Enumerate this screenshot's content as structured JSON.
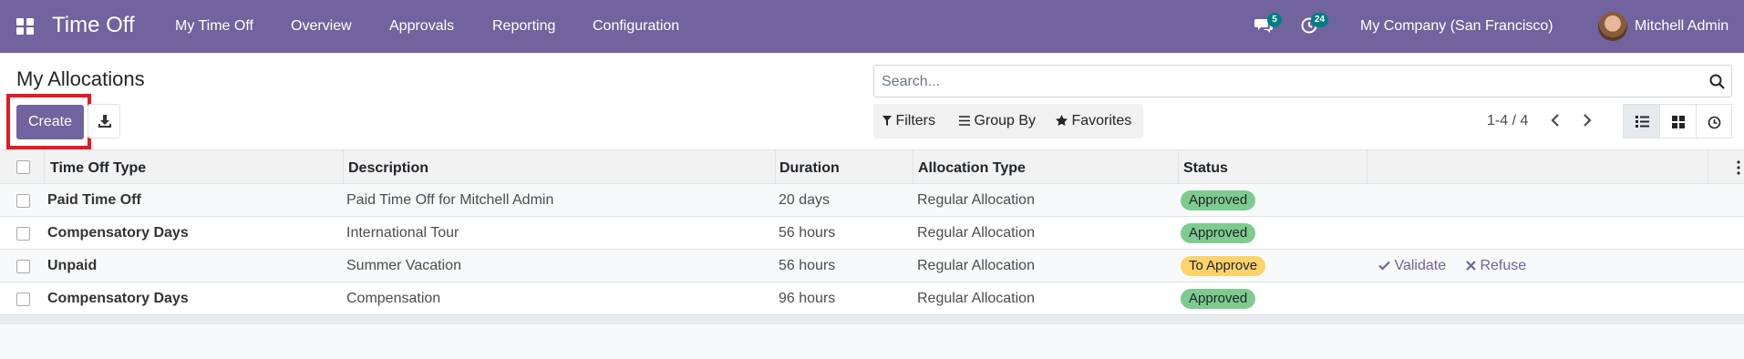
{
  "navbar": {
    "brand": "Time Off",
    "menu": [
      "My Time Off",
      "Overview",
      "Approvals",
      "Reporting",
      "Configuration"
    ],
    "messages_count": "5",
    "activities_count": "24",
    "company": "My Company (San Francisco)",
    "user": "Mitchell Admin",
    "color": "#71639e"
  },
  "page": {
    "title": "My Allocations",
    "create_label": "Create"
  },
  "search": {
    "placeholder": "Search..."
  },
  "filters": {
    "filters_label": "Filters",
    "groupby_label": "Group By",
    "favorites_label": "Favorites"
  },
  "pager": {
    "value": "1-4 / 4"
  },
  "table": {
    "headers": [
      "Time Off Type",
      "Description",
      "Duration",
      "Allocation Type",
      "Status"
    ],
    "rows": [
      {
        "type": "Paid Time Off",
        "description": "Paid Time Off for Mitchell Admin",
        "duration": "20 days",
        "allocation": "Regular Allocation",
        "status": "Approved"
      },
      {
        "type": "Compensatory Days",
        "description": "International Tour",
        "duration": "56 hours",
        "allocation": "Regular Allocation",
        "status": "Approved"
      },
      {
        "type": "Unpaid",
        "description": "Summer Vacation",
        "duration": "56 hours",
        "allocation": "Regular Allocation",
        "status": "To Approve",
        "validate": "Validate",
        "refuse": "Refuse"
      },
      {
        "type": "Compensatory Days",
        "description": "Compensation",
        "duration": "96 hours",
        "allocation": "Regular Allocation",
        "status": "Approved"
      }
    ]
  },
  "icons": [
    "apps-icon",
    "chat-icon",
    "clock-icon",
    "download-icon",
    "search-icon",
    "filter-icon",
    "groupby-icon",
    "star-icon",
    "chevron-left-icon",
    "chevron-right-icon",
    "list-view-icon",
    "kanban-view-icon",
    "activity-view-icon",
    "check-icon",
    "times-icon",
    "kebab-icon"
  ]
}
